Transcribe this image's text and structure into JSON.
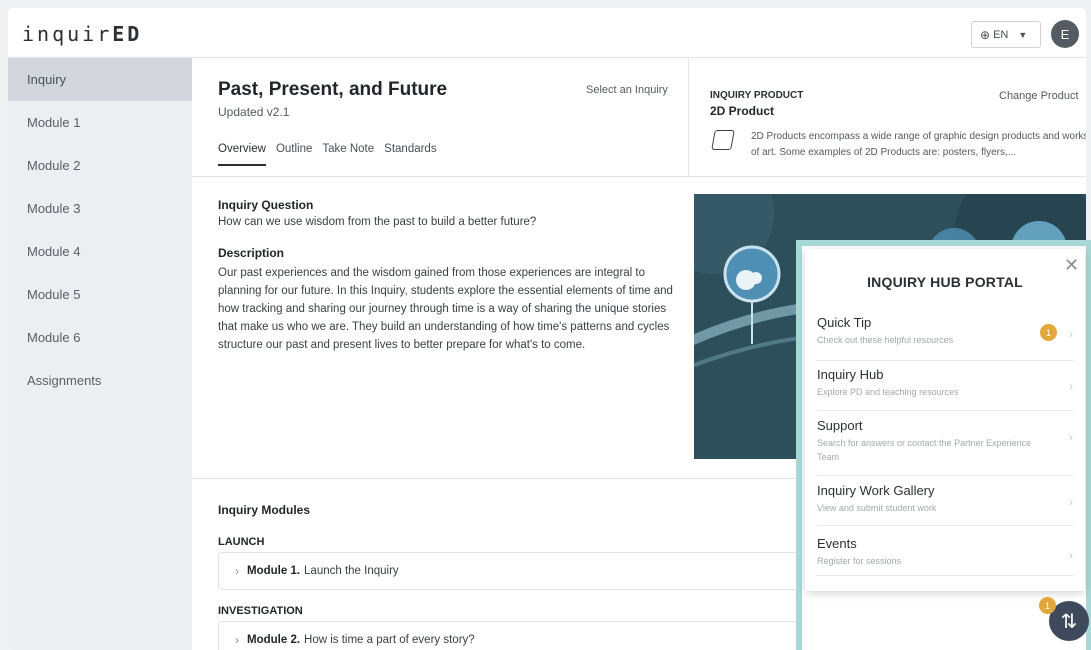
{
  "header": {
    "logo_prefix": "inquir",
    "logo_bold": "ED",
    "lang_label": "EN",
    "avatar_initial": "E"
  },
  "sidebar": {
    "items": [
      {
        "label": "Inquiry",
        "active": true
      },
      {
        "label": "Module 1"
      },
      {
        "label": "Module 2"
      },
      {
        "label": "Module 3"
      },
      {
        "label": "Module 4"
      },
      {
        "label": "Module 5"
      },
      {
        "label": "Module 6"
      },
      {
        "label": "Assignments"
      }
    ]
  },
  "inquiry": {
    "title": "Past, Present, and Future",
    "version": "Updated v2.1",
    "select_label": "Select an Inquiry",
    "tabs": [
      "Overview",
      "Outline",
      "Take Note",
      "Standards"
    ],
    "question_heading": "Inquiry Question",
    "question": "How can we use wisdom from the past to build a better future?",
    "description_heading": "Description",
    "description": "Our past experiences and the wisdom gained from those experiences are integral to planning for our future. In this Inquiry, students explore the essential elements of time and how tracking and sharing our journey through time is a way of sharing the unique stories that make us who we are. They build an understanding of how time's patterns and cycles structure our past and present lives to better prepare for what's to come."
  },
  "product": {
    "label": "INQUIRY PRODUCT",
    "name": "2D Product",
    "change_label": "Change Product",
    "description": "2D Products encompass a wide range of graphic design products and works of art. Some examples of 2D Products are: posters, flyers,..."
  },
  "modules": {
    "heading": "Inquiry Modules",
    "stages": [
      {
        "name": "LAUNCH",
        "module_num": "Module 1.",
        "module_title": "Launch the Inquiry"
      },
      {
        "name": "INVESTIGATION",
        "module_num": "Module 2.",
        "module_title": "How is time a part of every story?"
      }
    ]
  },
  "portal": {
    "title": "INQUIRY HUB PORTAL",
    "items": [
      {
        "title": "Quick Tip",
        "subtitle": "Check out these helpful resources",
        "badge": "1"
      },
      {
        "title": "Inquiry Hub",
        "subtitle": "Explore PD and teaching resources"
      },
      {
        "title": "Support",
        "subtitle": "Search for answers or contact the Partner Experience Team"
      },
      {
        "title": "Inquiry Work Gallery",
        "subtitle": "View and submit student work"
      },
      {
        "title": "Events",
        "subtitle": "Register for sessions"
      }
    ],
    "fab_badge": "1"
  },
  "colors": {
    "badge": "#e2a63a",
    "portal_border": "#a9d9d6",
    "sidebar_active": "#d3d7dd"
  }
}
